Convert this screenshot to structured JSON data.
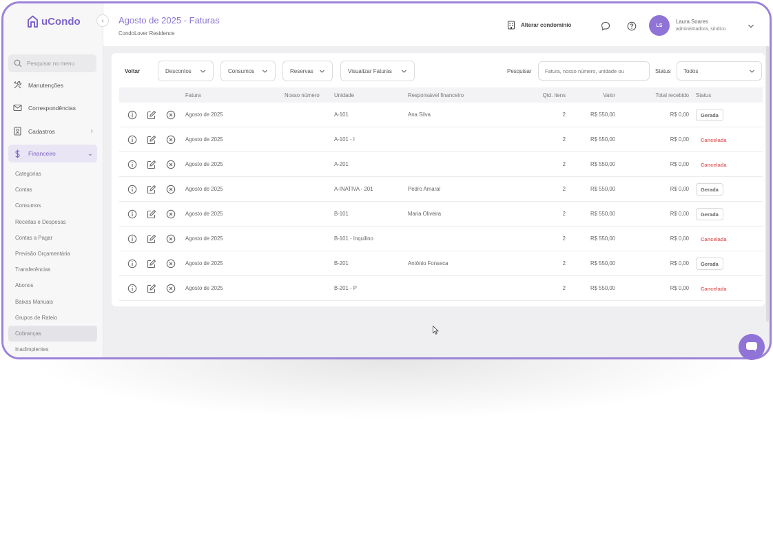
{
  "app": {
    "logo_text": "uCondo",
    "brand_color": "#8f73d6"
  },
  "sidebar": {
    "search_placeholder": "Pesquisar no menu",
    "items": [
      {
        "label": "Manutenções",
        "icon": "tools-icon"
      },
      {
        "label": "Correspondências",
        "icon": "mail-icon"
      },
      {
        "label": "Cadastros",
        "icon": "clipboard-icon"
      },
      {
        "label": "Financeiro",
        "icon": "dollar-icon"
      }
    ],
    "financeiro_sub": [
      "Categorias",
      "Contas",
      "Consumos",
      "Receitas e Despesas",
      "Contas a Pagar",
      "Previsão Orçamentária",
      "Transferências",
      "Abonos",
      "Baixas Manuais",
      "Grupos de Rateio",
      "Cobranças",
      "Inadimplentes"
    ]
  },
  "header": {
    "title": "Agosto de 2025 - Faturas",
    "subtitle": "CondoLover Residence",
    "change_condo": "Alterar condomínio",
    "user_initials": "LS",
    "user_name": "Laura Soares",
    "user_role": "administradora, síndico"
  },
  "toolbar": {
    "back": "Voltar",
    "descontos": "Descontos",
    "consumos": "Consumos",
    "reservas": "Reservas",
    "visualizar": "Visualizar Faturas",
    "search_label": "Pesquisar",
    "search_placeholder": "Fatura, nosso número, unidade ou",
    "status_label": "Status",
    "status_value": "Todos"
  },
  "table": {
    "headers": {
      "fatura": "Fatura",
      "nosso_numero": "Nosso número",
      "unidade": "Unidade",
      "responsavel": "Responsável financeiro",
      "qtd": "Qtd. itens",
      "valor": "Valor",
      "total": "Total recebido",
      "status": "Status"
    },
    "rows": [
      {
        "fatura": "Agosto de 2025",
        "unidade": "A-101",
        "responsavel": "Ana Silva",
        "qtd": "2",
        "valor": "R$ 550,00",
        "total": "R$ 0,00",
        "status": "Gerada"
      },
      {
        "fatura": "Agosto de 2025",
        "unidade": "A-101 - I",
        "responsavel": "",
        "qtd": "2",
        "valor": "R$ 550,00",
        "total": "R$ 0,00",
        "status": "Cancelada"
      },
      {
        "fatura": "Agosto de 2025",
        "unidade": "A-201",
        "responsavel": "",
        "qtd": "2",
        "valor": "R$ 550,00",
        "total": "R$ 0,00",
        "status": "Cancelada"
      },
      {
        "fatura": "Agosto de 2025",
        "unidade": "A-INATIVA - 201",
        "responsavel": "Pedro Amaral",
        "qtd": "2",
        "valor": "R$ 550,00",
        "total": "R$ 0,00",
        "status": "Gerada"
      },
      {
        "fatura": "Agosto de 2025",
        "unidade": "B-101",
        "responsavel": "Maria Oliveira",
        "qtd": "2",
        "valor": "R$ 550,00",
        "total": "R$ 0,00",
        "status": "Gerada"
      },
      {
        "fatura": "Agosto de 2025",
        "unidade": "B-101 - Inquilino",
        "responsavel": "",
        "qtd": "2",
        "valor": "R$ 550,00",
        "total": "R$ 0,00",
        "status": "Cancelada"
      },
      {
        "fatura": "Agosto de 2025",
        "unidade": "B-201",
        "responsavel": "Antônio Fonseca",
        "qtd": "2",
        "valor": "R$ 550,00",
        "total": "R$ 0,00",
        "status": "Gerada"
      },
      {
        "fatura": "Agosto de 2025",
        "unidade": "B-201 - P",
        "responsavel": "",
        "qtd": "2",
        "valor": "R$ 550,00",
        "total": "R$ 0,00",
        "status": "Cancelada"
      }
    ]
  }
}
